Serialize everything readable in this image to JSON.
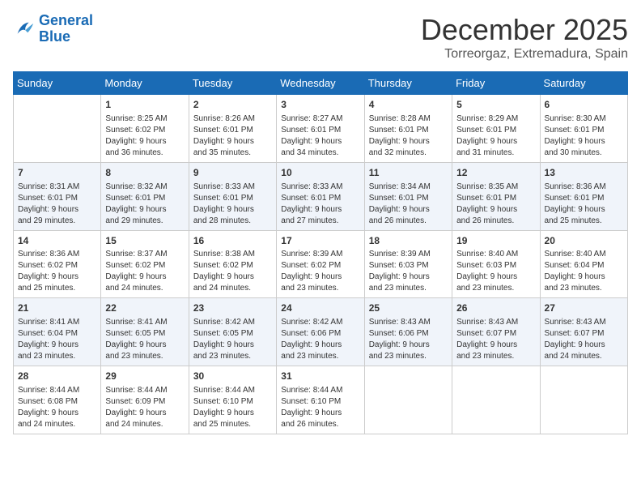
{
  "header": {
    "logo_line1": "General",
    "logo_line2": "Blue",
    "month": "December 2025",
    "location": "Torreorgaz, Extremadura, Spain"
  },
  "days_of_week": [
    "Sunday",
    "Monday",
    "Tuesday",
    "Wednesday",
    "Thursday",
    "Friday",
    "Saturday"
  ],
  "weeks": [
    [
      {
        "day": "",
        "content": ""
      },
      {
        "day": "1",
        "content": "Sunrise: 8:25 AM\nSunset: 6:02 PM\nDaylight: 9 hours\nand 36 minutes."
      },
      {
        "day": "2",
        "content": "Sunrise: 8:26 AM\nSunset: 6:01 PM\nDaylight: 9 hours\nand 35 minutes."
      },
      {
        "day": "3",
        "content": "Sunrise: 8:27 AM\nSunset: 6:01 PM\nDaylight: 9 hours\nand 34 minutes."
      },
      {
        "day": "4",
        "content": "Sunrise: 8:28 AM\nSunset: 6:01 PM\nDaylight: 9 hours\nand 32 minutes."
      },
      {
        "day": "5",
        "content": "Sunrise: 8:29 AM\nSunset: 6:01 PM\nDaylight: 9 hours\nand 31 minutes."
      },
      {
        "day": "6",
        "content": "Sunrise: 8:30 AM\nSunset: 6:01 PM\nDaylight: 9 hours\nand 30 minutes."
      }
    ],
    [
      {
        "day": "7",
        "content": "Sunrise: 8:31 AM\nSunset: 6:01 PM\nDaylight: 9 hours\nand 29 minutes."
      },
      {
        "day": "8",
        "content": "Sunrise: 8:32 AM\nSunset: 6:01 PM\nDaylight: 9 hours\nand 29 minutes."
      },
      {
        "day": "9",
        "content": "Sunrise: 8:33 AM\nSunset: 6:01 PM\nDaylight: 9 hours\nand 28 minutes."
      },
      {
        "day": "10",
        "content": "Sunrise: 8:33 AM\nSunset: 6:01 PM\nDaylight: 9 hours\nand 27 minutes."
      },
      {
        "day": "11",
        "content": "Sunrise: 8:34 AM\nSunset: 6:01 PM\nDaylight: 9 hours\nand 26 minutes."
      },
      {
        "day": "12",
        "content": "Sunrise: 8:35 AM\nSunset: 6:01 PM\nDaylight: 9 hours\nand 26 minutes."
      },
      {
        "day": "13",
        "content": "Sunrise: 8:36 AM\nSunset: 6:01 PM\nDaylight: 9 hours\nand 25 minutes."
      }
    ],
    [
      {
        "day": "14",
        "content": "Sunrise: 8:36 AM\nSunset: 6:02 PM\nDaylight: 9 hours\nand 25 minutes."
      },
      {
        "day": "15",
        "content": "Sunrise: 8:37 AM\nSunset: 6:02 PM\nDaylight: 9 hours\nand 24 minutes."
      },
      {
        "day": "16",
        "content": "Sunrise: 8:38 AM\nSunset: 6:02 PM\nDaylight: 9 hours\nand 24 minutes."
      },
      {
        "day": "17",
        "content": "Sunrise: 8:39 AM\nSunset: 6:02 PM\nDaylight: 9 hours\nand 23 minutes."
      },
      {
        "day": "18",
        "content": "Sunrise: 8:39 AM\nSunset: 6:03 PM\nDaylight: 9 hours\nand 23 minutes."
      },
      {
        "day": "19",
        "content": "Sunrise: 8:40 AM\nSunset: 6:03 PM\nDaylight: 9 hours\nand 23 minutes."
      },
      {
        "day": "20",
        "content": "Sunrise: 8:40 AM\nSunset: 6:04 PM\nDaylight: 9 hours\nand 23 minutes."
      }
    ],
    [
      {
        "day": "21",
        "content": "Sunrise: 8:41 AM\nSunset: 6:04 PM\nDaylight: 9 hours\nand 23 minutes."
      },
      {
        "day": "22",
        "content": "Sunrise: 8:41 AM\nSunset: 6:05 PM\nDaylight: 9 hours\nand 23 minutes."
      },
      {
        "day": "23",
        "content": "Sunrise: 8:42 AM\nSunset: 6:05 PM\nDaylight: 9 hours\nand 23 minutes."
      },
      {
        "day": "24",
        "content": "Sunrise: 8:42 AM\nSunset: 6:06 PM\nDaylight: 9 hours\nand 23 minutes."
      },
      {
        "day": "25",
        "content": "Sunrise: 8:43 AM\nSunset: 6:06 PM\nDaylight: 9 hours\nand 23 minutes."
      },
      {
        "day": "26",
        "content": "Sunrise: 8:43 AM\nSunset: 6:07 PM\nDaylight: 9 hours\nand 23 minutes."
      },
      {
        "day": "27",
        "content": "Sunrise: 8:43 AM\nSunset: 6:07 PM\nDaylight: 9 hours\nand 24 minutes."
      }
    ],
    [
      {
        "day": "28",
        "content": "Sunrise: 8:44 AM\nSunset: 6:08 PM\nDaylight: 9 hours\nand 24 minutes."
      },
      {
        "day": "29",
        "content": "Sunrise: 8:44 AM\nSunset: 6:09 PM\nDaylight: 9 hours\nand 24 minutes."
      },
      {
        "day": "30",
        "content": "Sunrise: 8:44 AM\nSunset: 6:10 PM\nDaylight: 9 hours\nand 25 minutes."
      },
      {
        "day": "31",
        "content": "Sunrise: 8:44 AM\nSunset: 6:10 PM\nDaylight: 9 hours\nand 26 minutes."
      },
      {
        "day": "",
        "content": ""
      },
      {
        "day": "",
        "content": ""
      },
      {
        "day": "",
        "content": ""
      }
    ]
  ]
}
